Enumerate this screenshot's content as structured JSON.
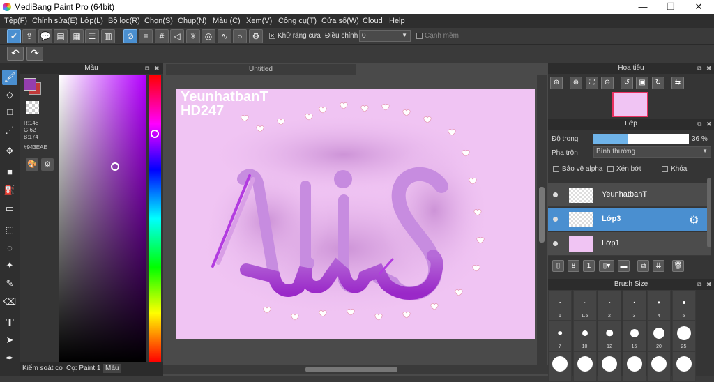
{
  "window": {
    "title": "MediBang Paint Pro (64bit)"
  },
  "menu": [
    "Tệp(F)",
    "Chỉnh sửa(E)",
    "Lớp(L)",
    "Bộ lọc(R)",
    "Chọn(S)",
    "Chụp(N)",
    "Màu (C)",
    "Xem(V)",
    "Công cụ(T)",
    "Cửa sổ(W)",
    "Cloud",
    "Help"
  ],
  "toolbar": {
    "antialias_label": "Khử răng cưa",
    "adjust_label": "Điều chỉnh",
    "adjust_value": "0",
    "soft_edge_label": "Cạnh mềm"
  },
  "color_panel": {
    "title": "Màu",
    "r": "R:148",
    "g": "G:62",
    "b": "B:174",
    "hex": "#943EAE",
    "fg_color": "#943EAE"
  },
  "bottom_tabs": {
    "tab1": "Kiểm soát co",
    "tab2": "Cọ: Paint 1",
    "tab3": "Màu"
  },
  "document": {
    "tab_title": "Untitled"
  },
  "canvas_text": {
    "line1": "YeunhatbanT",
    "line2": "HD247"
  },
  "navigator": {
    "title": "Hoa tiêu"
  },
  "layers": {
    "title": "Lớp",
    "opacity_label": "Độ trong",
    "opacity_value": "36 %",
    "opacity_fraction": 0.36,
    "blend_label": "Pha trộn",
    "blend_value": "Bình thường",
    "protect_alpha": "Bảo vệ alpha",
    "clipping": "Xén bớt",
    "lock": "Khóa",
    "items": [
      {
        "name": "YeunhatbanT",
        "selected": false
      },
      {
        "name": "Lớp3",
        "selected": true
      },
      {
        "name": "Lớp1",
        "selected": false
      }
    ]
  },
  "brush_size": {
    "title": "Brush Size",
    "sizes": [
      "1",
      "1.5",
      "2",
      "3",
      "4",
      "5",
      "7",
      "10",
      "12",
      "15",
      "20",
      "25"
    ]
  }
}
